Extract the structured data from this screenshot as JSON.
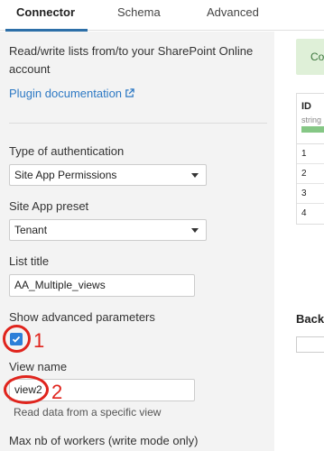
{
  "tabs": [
    {
      "label": "Connector",
      "active": true
    },
    {
      "label": "Schema",
      "active": false
    },
    {
      "label": "Advanced",
      "active": false
    }
  ],
  "connector": {
    "description": "Read/write lists from/to your SharePoint Online account",
    "doc_link": "Plugin documentation",
    "auth_label": "Type of authentication",
    "auth_value": "Site App Permissions",
    "preset_label": "Site App preset",
    "preset_value": "Tenant",
    "list_title_label": "List title",
    "list_title_value": "AA_Multiple_views",
    "advanced_label": "Show advanced parameters",
    "advanced_checked": true,
    "view_name_label": "View name",
    "view_name_value": "view2",
    "view_name_help": "Read data from a specific view",
    "workers_label": "Max nb of workers (write mode only)"
  },
  "annotations": [
    "1",
    "2"
  ],
  "preview": {
    "banner": "Co",
    "column": {
      "name": "ID",
      "type": "string"
    },
    "rows": [
      "1",
      "2",
      "3",
      "4"
    ],
    "back_label": "Back"
  },
  "colors": {
    "accent": "#2d6fa8",
    "link": "#2d79c4",
    "annotation": "#e0241d",
    "success_bg": "#dff0d8"
  }
}
